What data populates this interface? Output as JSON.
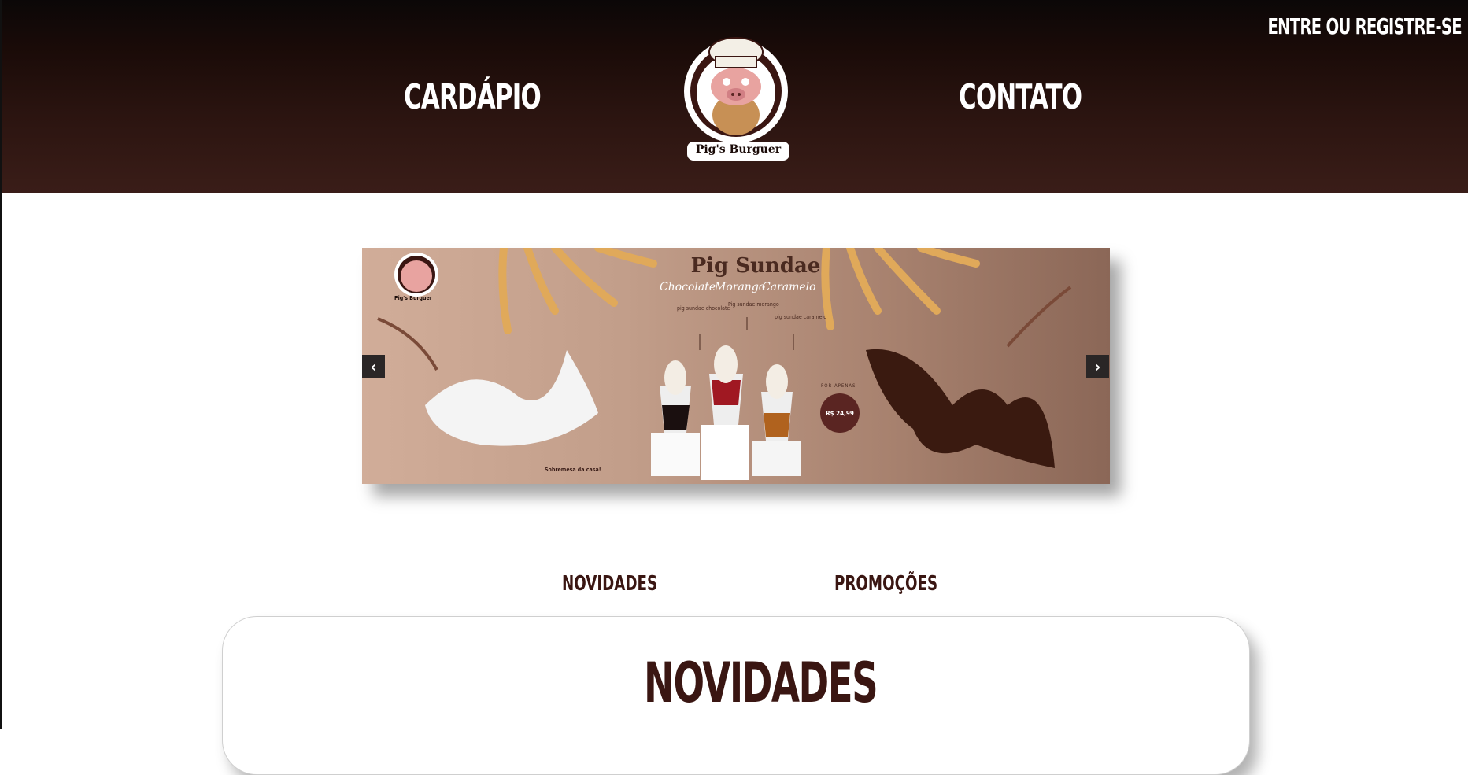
{
  "header": {
    "nav_left": "CARDÁPIO",
    "nav_right": "CONTATO",
    "login": "ENTRE OU REGISTRE-SE",
    "logo_text": "Pig's Burguer"
  },
  "banner": {
    "title": "Pig Sundae",
    "flavors": [
      "Chocolate",
      "Morango",
      "Caramelo"
    ],
    "items": [
      "pig sundae chocolate",
      "Pig sundae morango",
      "pig sundae caramelo"
    ],
    "price_caption": "POR APENAS",
    "price": "R$ 24,99",
    "tagline": "Sobremesa da casa!",
    "logo_text": "Pig's Burguer",
    "prev": "‹",
    "next": "›"
  },
  "tabs": [
    "NOVIDADES",
    "PROMOÇÕES"
  ],
  "section": {
    "title": "NOVIDADES"
  },
  "colors": {
    "header_dark": "#0b0707",
    "header_brown": "#3a1d18",
    "accent_brown": "#3a1612",
    "price_badge": "#5a2522"
  }
}
